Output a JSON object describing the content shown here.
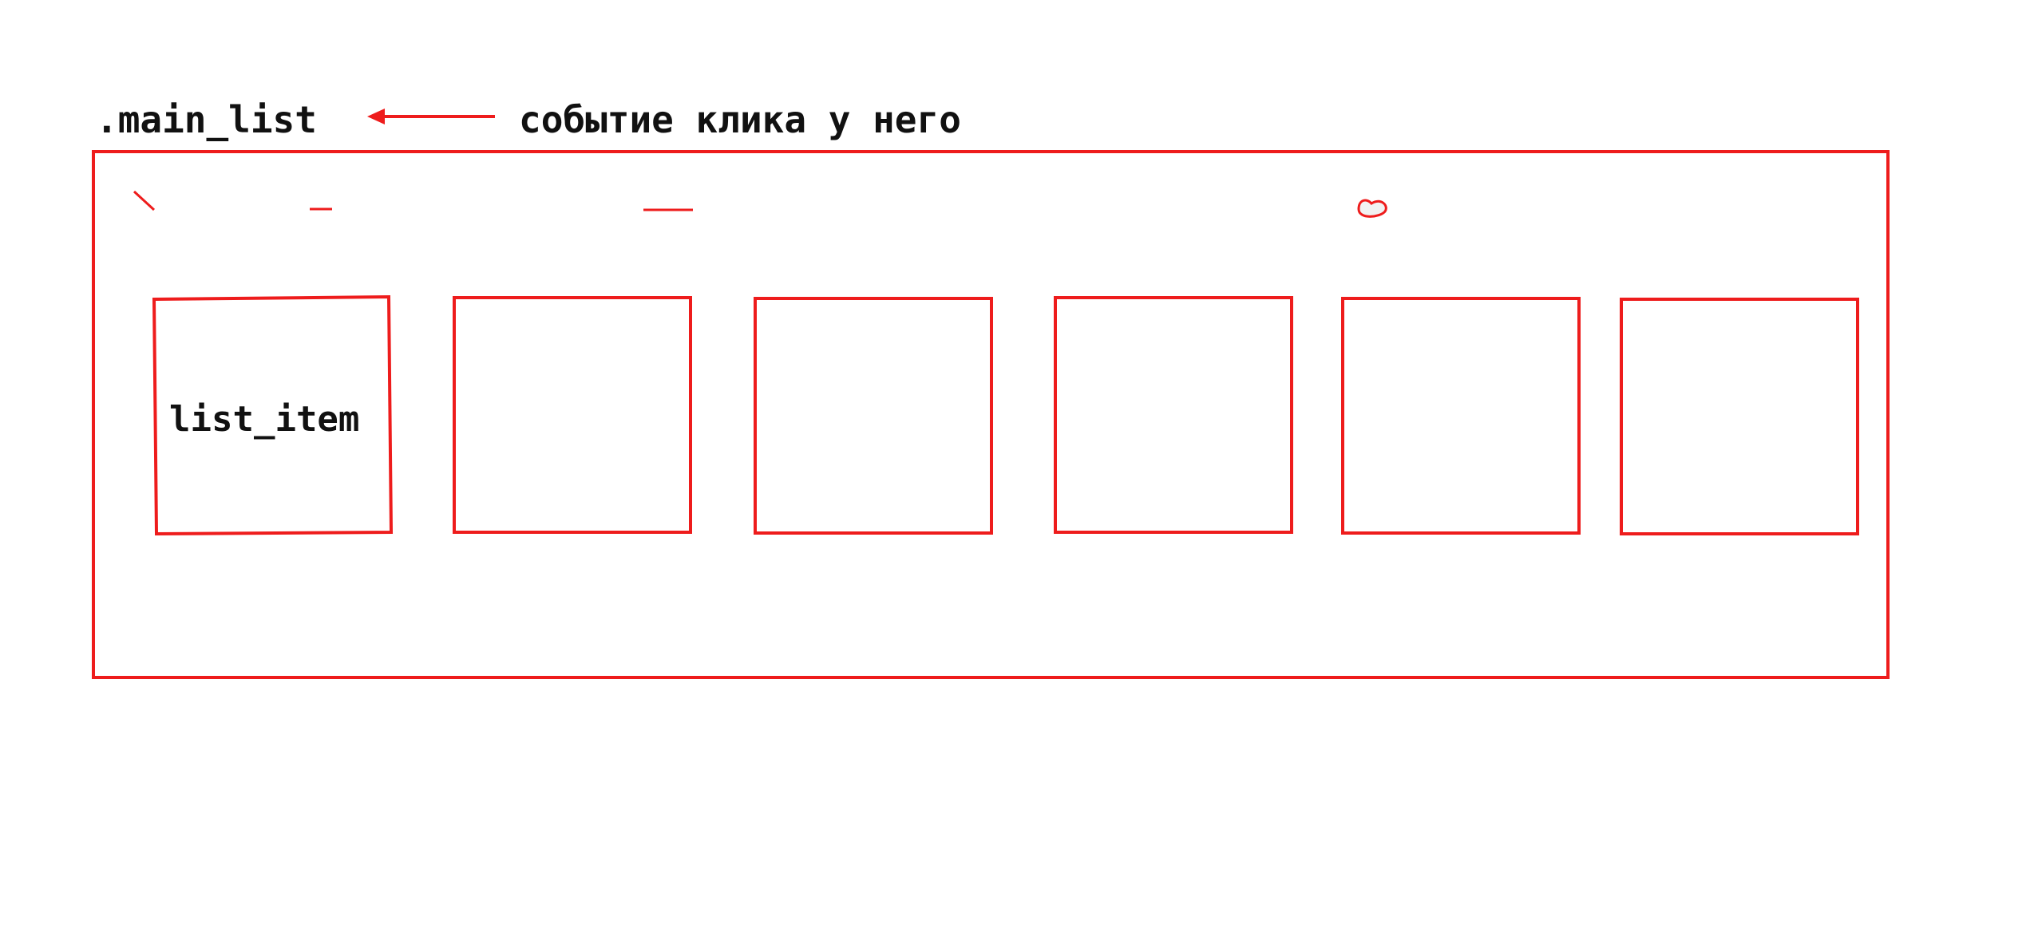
{
  "labels": {
    "container": ".main_list",
    "event_note": "событие клика у него",
    "item": "list_item"
  },
  "colors": {
    "stroke": "#ee1c1c",
    "text": "#111111",
    "background": "#ffffff"
  },
  "diagram": {
    "item_count": 6,
    "arrow_direction": "left"
  }
}
